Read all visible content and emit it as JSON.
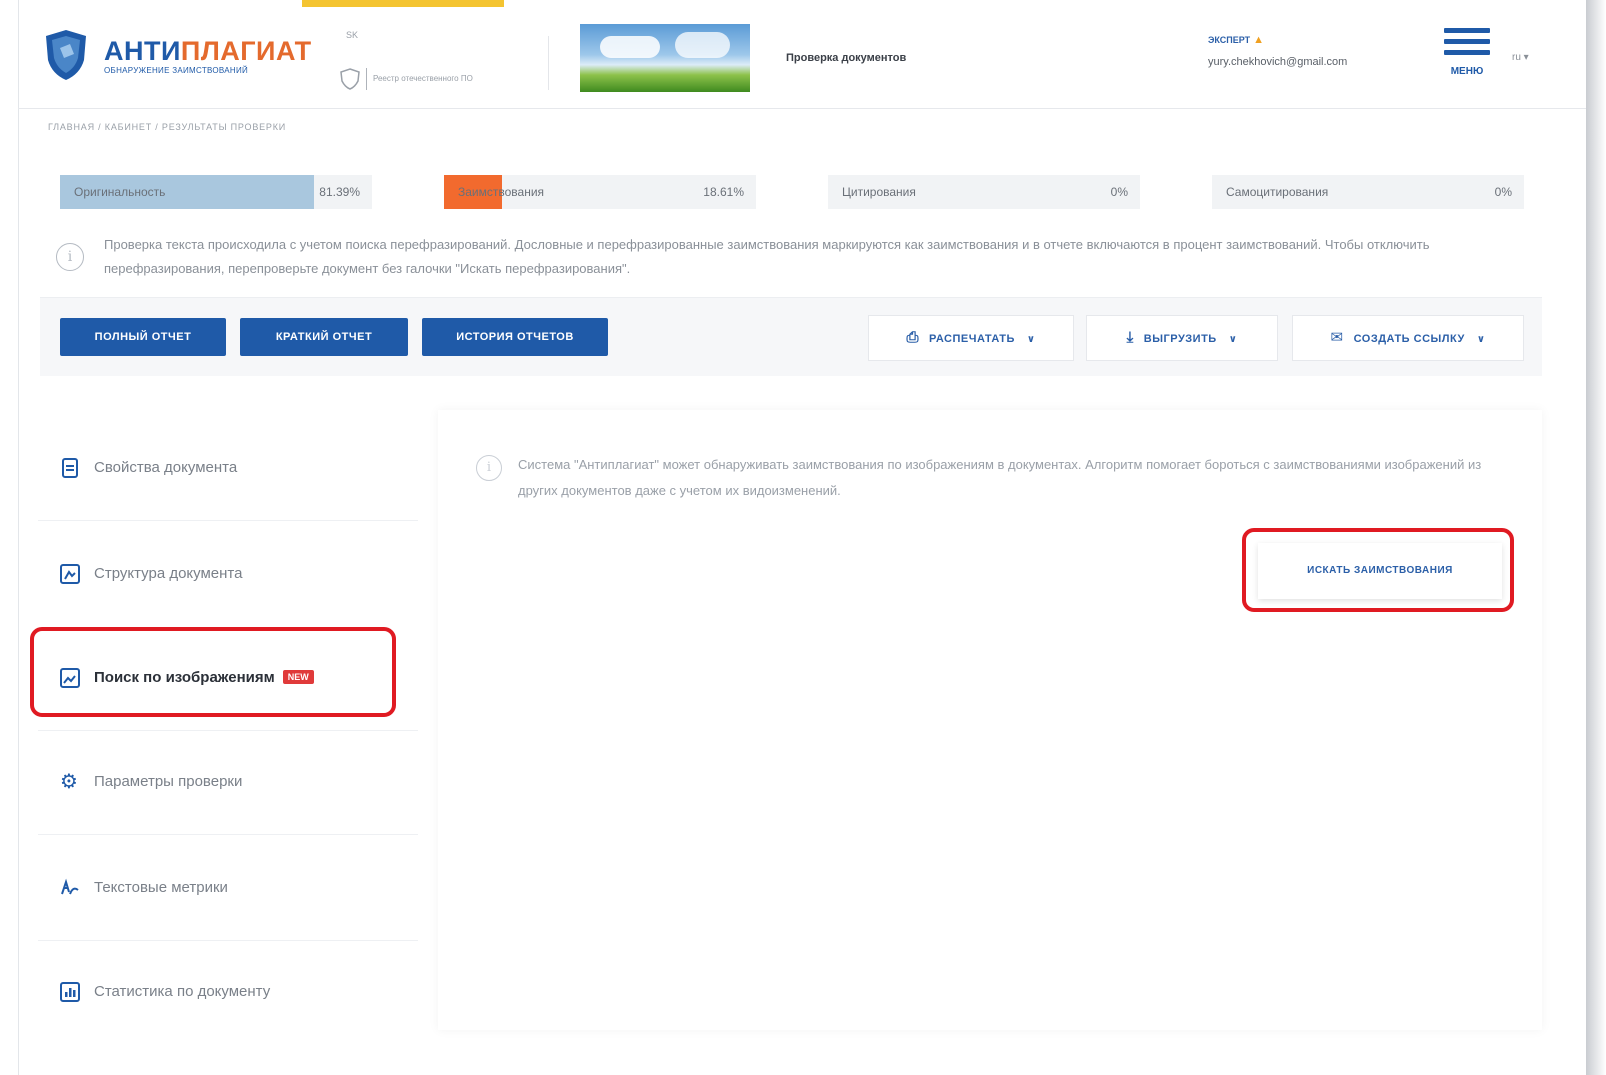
{
  "header": {
    "logo_title_part1": "АНТИ",
    "logo_title_part2": "ПЛАГИАТ",
    "logo_subtitle": "ОБНАРУЖЕНИЕ ЗАИМСТВОВАНИЙ",
    "mini_text": "SK",
    "registry_text": "Реестр отечественного ПО",
    "page_title": "Проверка документов",
    "user_role": "ЭКСПЕРТ",
    "user_email": "yury.chekhovich@gmail.com",
    "menu_label": "МЕНЮ",
    "language": "ru ▾"
  },
  "breadcrumb": "ГЛАВНАЯ / КАБИНЕТ / РЕЗУЛЬТАТЫ ПРОВЕРКИ",
  "stats": [
    {
      "label": "Оригинальность",
      "value": "81.39%",
      "percent": 81.39,
      "color": "#a9c7de"
    },
    {
      "label": "Заимствования",
      "value": "18.61%",
      "percent": 18.61,
      "color": "#f26a2e"
    },
    {
      "label": "Цитирования",
      "value": "0%",
      "percent": 0,
      "color": "#cfe0ee"
    },
    {
      "label": "Самоцитирования",
      "value": "0%",
      "percent": 0,
      "color": "#cfe0ee"
    }
  ],
  "info_text": "Проверка текста происходила с учетом поиска перефразирований. Дословные и перефразированные заимствования маркируются как заимствования и в отчете включаются в процент заимствований. Чтобы отключить перефразирования, перепроверьте документ без галочки \"Искать перефразирования\".",
  "actions": {
    "full_report": "ПОЛНЫЙ ОТЧЕТ",
    "short_report": "КРАТКИЙ ОТЧЕТ",
    "report_history": "ИСТОРИЯ ОТЧЕТОВ",
    "print": "РАСПЕЧАТАТЬ",
    "export": "ВЫГРУЗИТЬ",
    "create_link": "СОЗДАТЬ ССЫЛКУ"
  },
  "sidebar": {
    "items": [
      {
        "label": "Свойства документа",
        "icon": "document-icon"
      },
      {
        "label": "Структура документа",
        "icon": "structure-icon"
      },
      {
        "label": "Поиск по изображениям",
        "icon": "image-search-icon",
        "badge": "NEW",
        "active": true
      },
      {
        "label": "Параметры проверки",
        "icon": "gear-icon"
      },
      {
        "label": "Текстовые метрики",
        "icon": "metrics-icon"
      },
      {
        "label": "Статистика по документу",
        "icon": "stats-icon"
      }
    ]
  },
  "main": {
    "info_text": "Система \"Антиплагиат\" может обнаруживать заимствования по изображениям в документах. Алгоритм помогает бороться с заимствованиями изображений из других документов даже с учетом их видоизменений.",
    "search_button": "ИСКАТЬ ЗАИМСТВОВАНИЯ"
  },
  "colors": {
    "brand_blue": "#1f5aa8",
    "brand_orange": "#e46a2d",
    "highlight_red": "#e01a22",
    "top_accent": "#f4c431"
  }
}
